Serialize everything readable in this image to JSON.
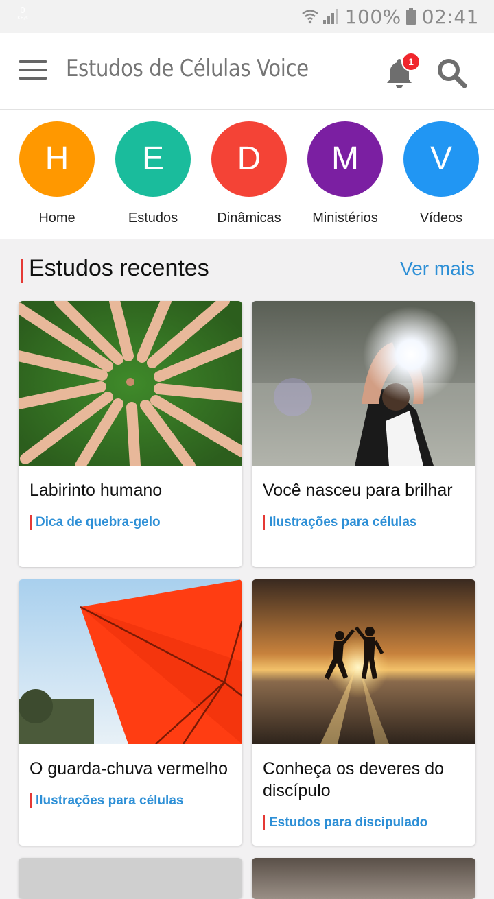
{
  "status_bar": {
    "net_speed_value": "0",
    "net_speed_unit": "KB/s",
    "battery": "100%",
    "time": "02:41"
  },
  "app_bar": {
    "title": "Estudos de Células Voice",
    "notification_count": "1"
  },
  "categories": [
    {
      "letter": "H",
      "label": "Home",
      "color": "#FF9800"
    },
    {
      "letter": "E",
      "label": "Estudos",
      "color": "#1ABC9C"
    },
    {
      "letter": "D",
      "label": "Dinâmicas",
      "color": "#F44336"
    },
    {
      "letter": "M",
      "label": "Ministérios",
      "color": "#7B1FA2"
    },
    {
      "letter": "V",
      "label": "Vídeos",
      "color": "#2196F3"
    }
  ],
  "recent": {
    "title": "Estudos recentes",
    "see_more": "Ver mais",
    "cards": [
      {
        "title": "Labirinto humano",
        "category": "Dica de quebra-gelo"
      },
      {
        "title": "Você nasceu para brilhar",
        "category": "Ilustrações para células"
      },
      {
        "title": "O guarda-chuva vermelho",
        "category": "Ilustrações para células"
      },
      {
        "title": "Conheça os deveres do discípulo",
        "category": "Estudos para discipulado"
      }
    ]
  },
  "colors": {
    "accent": "#2D8FD6",
    "tag_bar": "#E53935",
    "badge": "#F0262D"
  }
}
